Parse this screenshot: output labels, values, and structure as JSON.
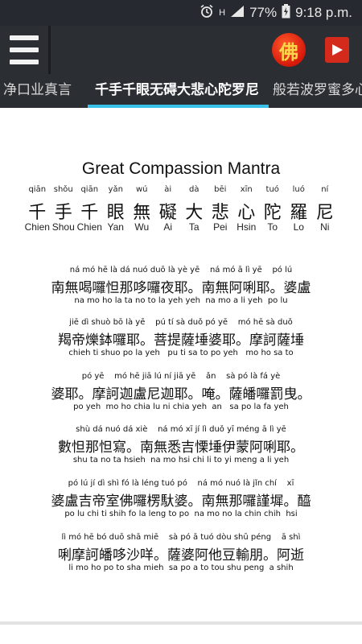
{
  "status": {
    "battery_pct": "77%",
    "time": "9:18 p.m.",
    "network": "H"
  },
  "appbar": {
    "fo_char": "佛"
  },
  "tabs": [
    "净口业真言",
    "千手千眼无碍大悲心陀罗尼",
    "般若波罗蜜多心"
  ],
  "title": "Great Compassion Mantra",
  "header_line": {
    "pinyin": [
      "qiān",
      "shǒu",
      "qiān",
      "yǎn",
      "wú",
      "ài",
      "dà",
      "bēi",
      "xīn",
      "tuó",
      "luó",
      "ní"
    ],
    "hanzi": [
      "千",
      "手",
      "千",
      "眼",
      "無",
      "礙",
      "大",
      "悲",
      "心",
      "陀",
      "羅",
      "尼"
    ],
    "english": [
      "Chien",
      "Shou",
      "Chien",
      "Yan",
      "Wu",
      "Ai",
      "Ta",
      "Pei",
      "Hsin",
      "To",
      "Lo",
      "Ni"
    ]
  },
  "verses": [
    {
      "pinyin": "ná mó hē là dá nuó duō là yè yē    ná mó ā lì yē    pó lú",
      "hanzi": "南無喝囉怛那哆囉夜耶。南無阿唎耶。婆盧",
      "english": "na mo ho la ta no to la yeh yeh  na mo a li yeh  po lu"
    },
    {
      "pinyin": "jiē dì shuò bō là yē    pú tí sà duǒ pó yē    mó hē sà duǒ",
      "hanzi": "羯帝爍鉢囉耶。菩提薩埵婆耶。摩訶薩埵",
      "english": "chieh ti shuo po la yeh   pu ti sa to po yeh   mo ho sa to"
    },
    {
      "pinyin": "pó yē    mó hē jiā lú ní jiā yē    ǎn    sà pó là fá yè",
      "hanzi": "婆耶。摩訶迦盧尼迦耶。唵。薩皤囉罰曳。",
      "english": "po yeh  mo ho chia lu ni chia yeh  an   sa po la fa yeh"
    },
    {
      "pinyin": "shù dá nuó dá xiè    ná mó xī jí lì duǒ yī méng ā lì yē",
      "hanzi": "數怛那怛寫。南無悉吉慄埵伊蒙阿唎耶。",
      "english": "shu ta no ta hsieh  na mo hsi chi li to yi meng a li yeh"
    },
    {
      "pinyin": "pó lú jí dì shì fó là léng tuó pó    ná mó nuó là jǐn chí    xī",
      "hanzi": "婆盧吉帝室佛囉楞馱婆。南無那囉謹墀。醯",
      "english": "po lu chi ti shih fo la leng to po  na mo no la chin chih  hsi"
    },
    {
      "pinyin": "lì mó hē bó duō shā miē    sà pó ā tuó dòu shū péng    ā shì",
      "hanzi": "唎摩訶皤哆沙咩。薩婆阿他豆輸朋。阿逝",
      "english": "li mo ho po to sha mieh  sa po a to tou shu peng  a shih"
    }
  ]
}
